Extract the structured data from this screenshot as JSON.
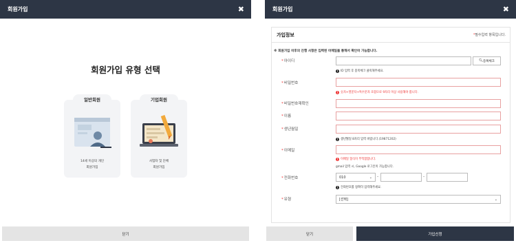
{
  "left": {
    "title": "회원가입",
    "close": "✖",
    "heading": "회원가입 유형 선택",
    "cards": [
      {
        "tab": "일반회원",
        "desc1": "14세 이상의 개인",
        "desc2": "회원가입"
      },
      {
        "tab": "기업회원",
        "desc1": "사업자 및 단체",
        "desc2": "회원가입"
      }
    ],
    "footer_close": "닫기"
  },
  "right": {
    "title": "회원가입",
    "close": "✖",
    "section_title": "가입정보",
    "required_star": "*",
    "required_text": "필수입력 항목입니다.",
    "notice": "※ 회원가입 이후의 진행 사항은 입력된 이메일을 통해서 확인이 가능합니다.",
    "fields": {
      "id": {
        "label": "아이디",
        "hint": "ID 입력 후 중복체크 클릭해주세요.",
        "dup_button": "중복체크"
      },
      "pw": {
        "label": "비밀번호",
        "hint": "숫자+영문자+특수문자 조합으로 9자리 이상 사용해야 합니다."
      },
      "pw2": {
        "label": "비밀번호재확인"
      },
      "name": {
        "label": "이름"
      },
      "birth": {
        "label": "생년월일",
        "hint": "생년월일 8자리 입력 바랍니다.(19871202)"
      },
      "email": {
        "label": "이메일",
        "hint": "이메일 형식이 부적합합니다.",
        "note": "gmail 입력 시, Google 로그인이 가능합니다."
      },
      "phone": {
        "label": "전화번호",
        "prefix": "010",
        "hint": "전화번호를 정확히 입력해주세요."
      },
      "type": {
        "label": "유형",
        "value": "[선택]"
      }
    },
    "footer_close": "닫기",
    "footer_submit": "가입신청"
  },
  "colors": {
    "header": "#2d3645",
    "required": "#ee3333",
    "card_bg": "#f3f4f6"
  }
}
